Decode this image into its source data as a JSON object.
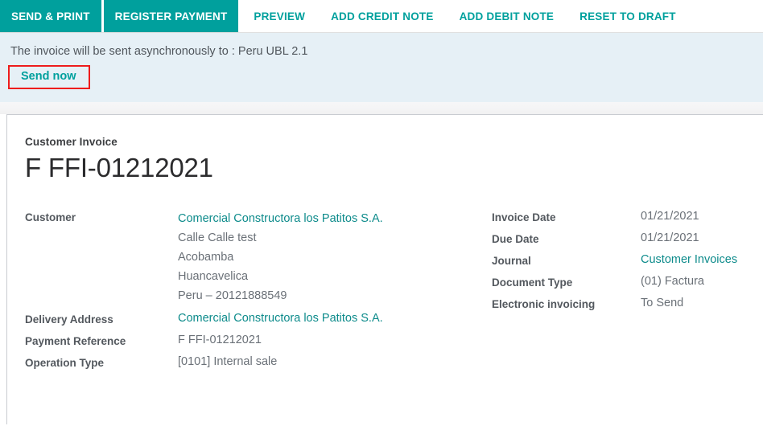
{
  "statusbar": {
    "buttons": [
      {
        "label": "SEND & PRINT",
        "style": "primary"
      },
      {
        "label": "REGISTER PAYMENT",
        "style": "primary"
      },
      {
        "label": "PREVIEW",
        "style": "link"
      },
      {
        "label": "ADD CREDIT NOTE",
        "style": "link"
      },
      {
        "label": "ADD DEBIT NOTE",
        "style": "link"
      },
      {
        "label": "RESET TO DRAFT",
        "style": "link"
      }
    ]
  },
  "alert": {
    "message": "The invoice will be sent asynchronously to : Peru UBL 2.1",
    "action_label": "Send now",
    "background_color": "#e6f0f6",
    "highlight_color": "#ee1c1c"
  },
  "form": {
    "subtitle": "Customer Invoice",
    "title": "F FFI-01212021",
    "left_fields": [
      {
        "label": "Customer",
        "value": "Comercial Constructora los Patitos S.A.",
        "is_link": true,
        "address_lines": [
          "Comercial Constructora los Patitos S.A.",
          "Calle Calle test",
          "Acobamba",
          "Huancavelica",
          "Peru – 20121888549"
        ]
      },
      {
        "label": "Delivery Address",
        "value": "Comercial Constructora los Patitos S.A.",
        "is_link": true
      },
      {
        "label": "Payment Reference",
        "value": "F FFI-01212021",
        "is_link": false
      },
      {
        "label": "Operation Type",
        "value": "[0101] Internal sale",
        "is_link": false
      }
    ],
    "right_fields": [
      {
        "label": "Invoice Date",
        "value": "01/21/2021",
        "is_link": false
      },
      {
        "label": "Due Date",
        "value": "01/21/2021",
        "is_link": false
      },
      {
        "label": "Journal",
        "value": "Customer Invoices",
        "is_link": true
      },
      {
        "label": "Document Type",
        "value": "(01) Factura",
        "is_link": false
      },
      {
        "label": "Electronic invoicing",
        "value": "To Send",
        "is_link": false
      }
    ]
  },
  "theme": {
    "accent": "#00a09d",
    "link": "#0d8b8b",
    "label": "#53585e",
    "value": "#6a7077"
  }
}
